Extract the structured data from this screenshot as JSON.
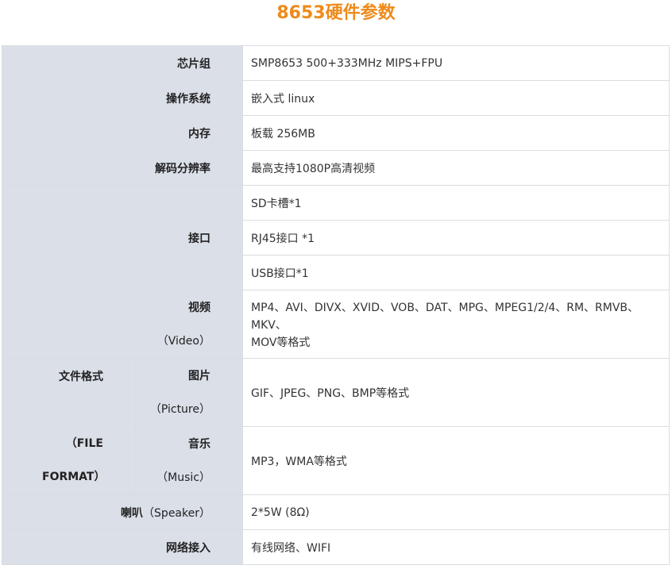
{
  "title": "8653硬件参数",
  "rows": {
    "chipset": {
      "label": "芯片组",
      "value": "SMP8653 500+333MHz MIPS+FPU"
    },
    "os": {
      "label": "操作系统",
      "value": "嵌入式 linux"
    },
    "memory": {
      "label": "内存",
      "value": "板载 256MB"
    },
    "resolution": {
      "label": "解码分辨率",
      "value": "最高支持1080P高清视频"
    },
    "interface": {
      "label": "接口",
      "values": [
        "SD卡槽*1",
        "RJ45接口 *1",
        "USB接口*1"
      ]
    },
    "video": {
      "label": "视频",
      "sublabel": "（Video）",
      "value_line1": "MP4、AVI、DIVX、XVID、VOB、DAT、MPG、MPEG1/2/4、RM、RMVB、",
      "value_line2": "MKV、",
      "value_line3": "MOV等格式"
    },
    "file_format": {
      "label_cn": "文件格式",
      "label_en1": "（FILE",
      "label_en2": "FORMAT）"
    },
    "picture": {
      "label": "图片",
      "sublabel": "（Picture）",
      "value": "GIF、JPEG、PNG、BMP等格式"
    },
    "music": {
      "label": "音乐",
      "sublabel": "（Music）",
      "value": "MP3，WMA等格式"
    },
    "speaker": {
      "label_cn": "喇叭",
      "label_en": "（Speaker）",
      "value": "2*5W (8Ω)"
    },
    "network": {
      "label": "网络接入",
      "value": "有线网络、WIFI"
    }
  }
}
